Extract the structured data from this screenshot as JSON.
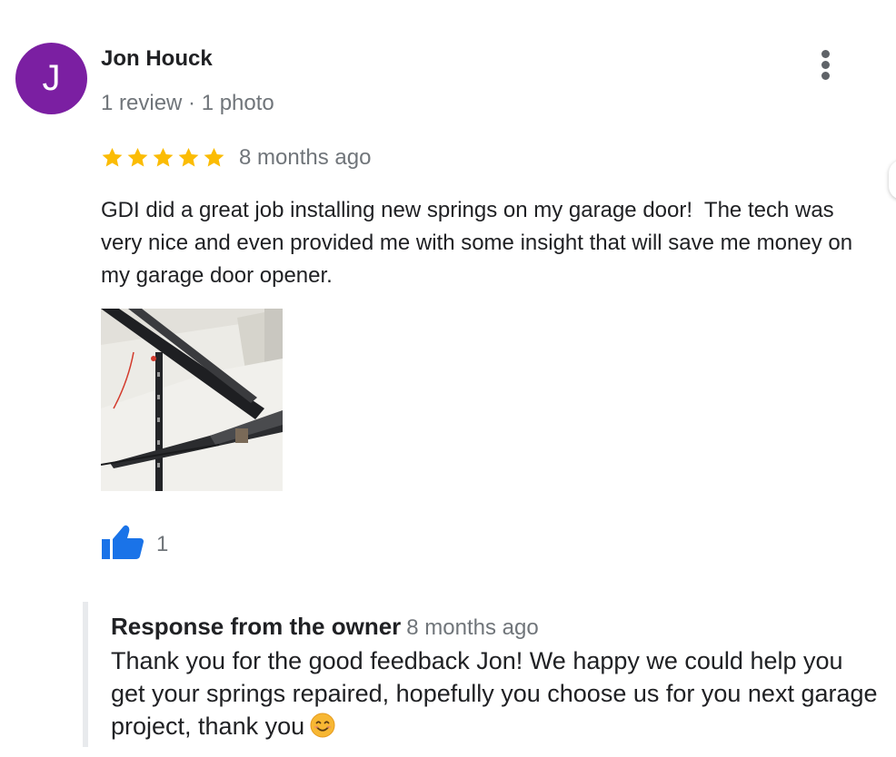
{
  "reviewer": {
    "initial": "J",
    "name": "Jon Houck",
    "meta": "1 review · 1 photo",
    "avatar_color": "#7b1fa2"
  },
  "review": {
    "rating": 5,
    "max_rating": 5,
    "date": "8 months ago",
    "text": "GDI did a great job installing new springs on my garage door!  The tech was very nice and even provided me with some insight that will save me money on my garage door opener.",
    "like_count": "1",
    "star_color": "#fbbc04",
    "like_color": "#1a73e8"
  },
  "icons": {
    "more": "more-vertical-icon",
    "star": "star-icon",
    "like": "thumbs-up-icon",
    "emoji": "smiling-face-emoji"
  },
  "owner_response": {
    "title": "Response from the owner",
    "date": "8 months ago",
    "text": "Thank you for the good feedback Jon! We happy we could help you get your springs repaired, hopefully you choose us for you next garage project, thank you"
  }
}
